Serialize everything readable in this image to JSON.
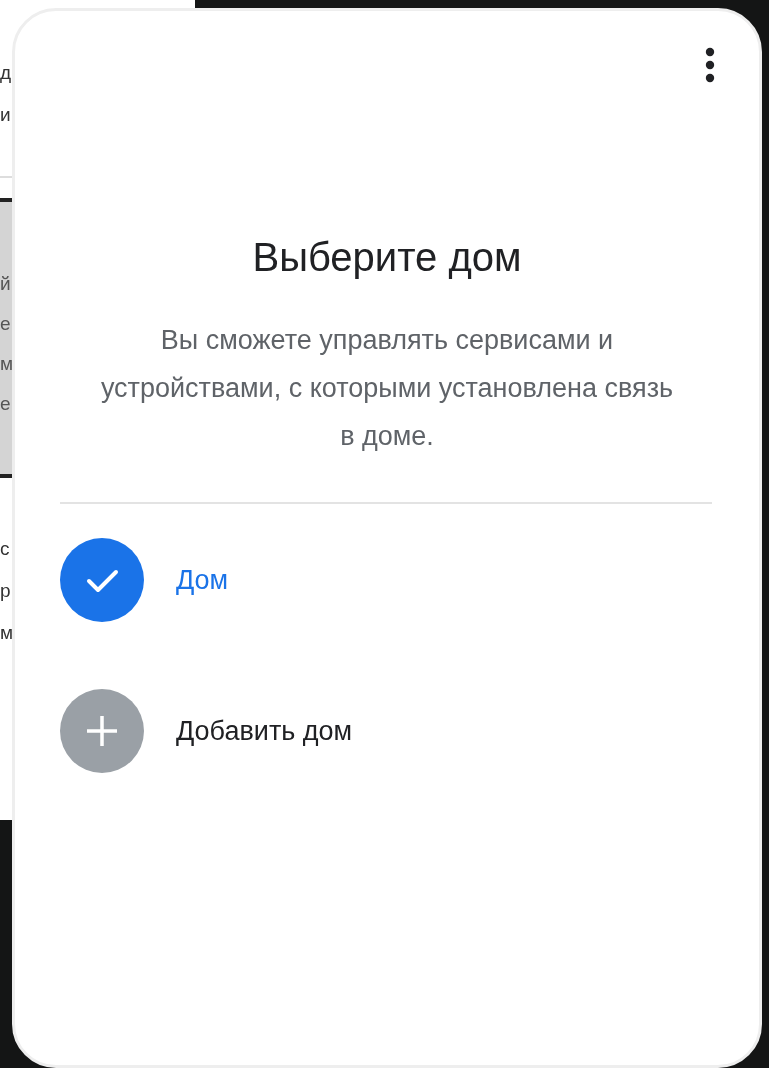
{
  "background_fragments": [
    {
      "text": "д",
      "shaded": false
    },
    {
      "text": "и",
      "shaded": false
    },
    {
      "text": "й",
      "shaded": true
    },
    {
      "text": "е",
      "shaded": true
    },
    {
      "text": "м",
      "shaded": true
    },
    {
      "text": "е",
      "shaded": true
    },
    {
      "text": "с",
      "shaded": false
    },
    {
      "text": "р",
      "shaded": false
    },
    {
      "text": "м",
      "shaded": false
    }
  ],
  "dialog": {
    "title": "Выберите дом",
    "description": "Вы сможете управлять сервисами и устройствами, с которыми установлена связь в доме.",
    "homes": [
      {
        "kind": "home",
        "label": "Дом",
        "selected": true
      },
      {
        "kind": "add",
        "label": "Добавить дом",
        "selected": false
      }
    ]
  }
}
